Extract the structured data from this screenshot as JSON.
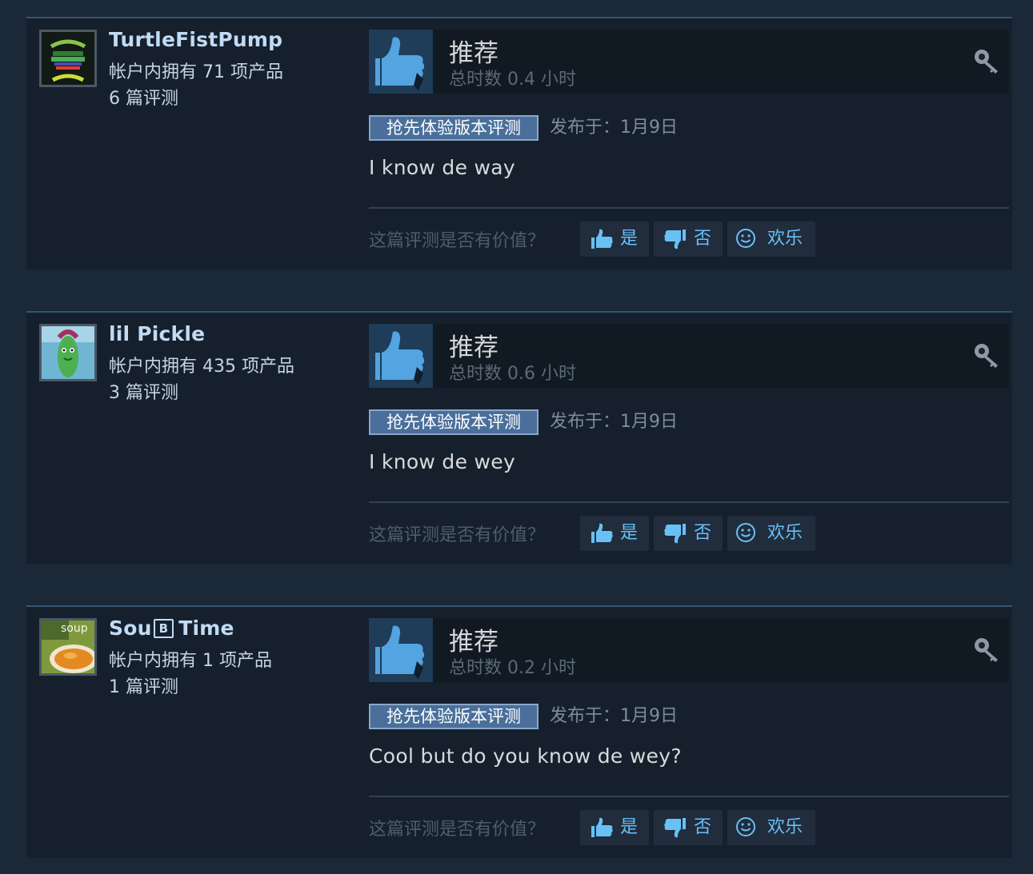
{
  "labels": {
    "recommended": "推荐",
    "early_access": "抢先体验版本评测",
    "helpful_question": "这篇评测是否有价值？",
    "yes": "是",
    "no": "否",
    "funny": "欢乐"
  },
  "reviews": [
    {
      "user_name": "TurtleFistPump",
      "products_owned": "帐户内拥有 71 项产品",
      "review_count": "6 篇评测",
      "hours": "总时数 0.4 小时",
      "posted": "发布于：1月9日",
      "text": "I know de way",
      "avatar_icon": "turtle-power-avatar"
    },
    {
      "user_name": "lil Pickle",
      "products_owned": "帐户内拥有 435 项产品",
      "review_count": "3 篇评测",
      "hours": "总时数 0.6 小时",
      "posted": "发布于：1月9日",
      "text": "I know de wey",
      "avatar_icon": "pickle-avatar"
    },
    {
      "user_name_pre": "Sou",
      "user_name_badge": "B",
      "user_name_post": "Time",
      "products_owned": "帐户内拥有 1 项产品",
      "review_count": "1 篇评测",
      "hours": "总时数 0.2 小时",
      "posted": "发布于：1月9日",
      "text": "Cool but do you know de wey?",
      "avatar_icon": "soup-avatar",
      "avatar_label": "soup"
    }
  ],
  "colors": {
    "page_bg": "#1b2838",
    "card_bg": "#16202d",
    "username": "#c1dbf4",
    "vote_text": "#67c1f5",
    "thumb": "#53a4e0",
    "badge_bg": "#4a6f9a"
  }
}
